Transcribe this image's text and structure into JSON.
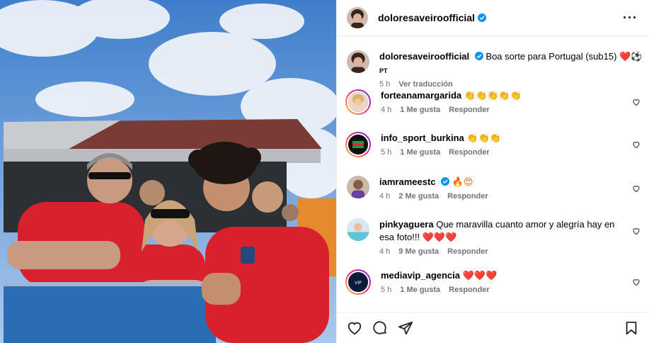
{
  "post": {
    "author": "doloresaveiroofficial",
    "caption_user": "doloresaveiroofficial",
    "caption_text": "Boa sorte para Portugal (sub15)",
    "caption_emoji": "❤️⚽",
    "caption_flag": "PT",
    "caption_time": "5 h",
    "translate_label": "Ver traducción"
  },
  "comments": [
    {
      "user": "forteanamargarida",
      "text": "",
      "emoji": "👏👏👏👏👏",
      "time": "4 h",
      "likes": "1 Me gusta",
      "reply": "Responder"
    },
    {
      "user": "info_sport_burkina",
      "text": "",
      "emoji": "👏👏👏",
      "time": "5 h",
      "likes": "1 Me gusta",
      "reply": "Responder"
    },
    {
      "user": "iamrameestc",
      "text": "",
      "emoji": "🔥😍",
      "time": "4 h",
      "likes": "2 Me gusta",
      "reply": "Responder"
    },
    {
      "user": "pinkyaguera",
      "text": "Que maravilla cuanto amor y alegría hay en esa foto!!!",
      "emoji": "❤️❤️❤️",
      "time": "4 h",
      "likes": "9 Me gusta",
      "reply": "Responder"
    },
    {
      "user": "mediavip_agencia",
      "text": "",
      "emoji": "❤️❤️❤️",
      "time": "5 h",
      "likes": "1 Me gusta",
      "reply": "Responder"
    }
  ],
  "icons": {
    "more": "more-horizontal-icon",
    "like": "heart-icon",
    "comment": "comment-icon",
    "share": "share-icon",
    "save": "bookmark-icon",
    "verified": "verified-badge-icon"
  },
  "colors": {
    "verified": "#0095f6",
    "meta_text": "#737373",
    "divider": "#efefef",
    "jersey_red": "#d9212e"
  }
}
